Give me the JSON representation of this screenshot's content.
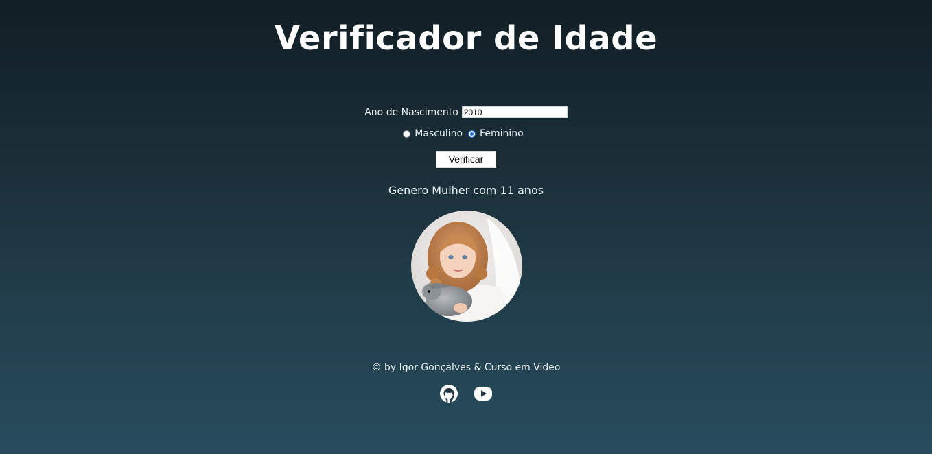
{
  "page": {
    "title": "Verificador de Idade"
  },
  "form": {
    "year_label": "Ano de Nascimento",
    "year_value": "2010",
    "gender_options": [
      {
        "label": "Masculino",
        "checked": false
      },
      {
        "label": "Feminino",
        "checked": true
      }
    ],
    "verify_label": "Verificar"
  },
  "result": {
    "text": "Genero Mulher com 11 anos",
    "image": "girl-with-rabbit-photo"
  },
  "footer": {
    "credit": "© by Igor Gonçalves & Curso em Video",
    "icons": [
      "github-icon",
      "youtube-icon"
    ]
  },
  "colors": {
    "background_top": "#111e25",
    "background_bottom": "#274c5d",
    "text": "#e9f1f4",
    "radio_accent": "#1a73e8"
  }
}
